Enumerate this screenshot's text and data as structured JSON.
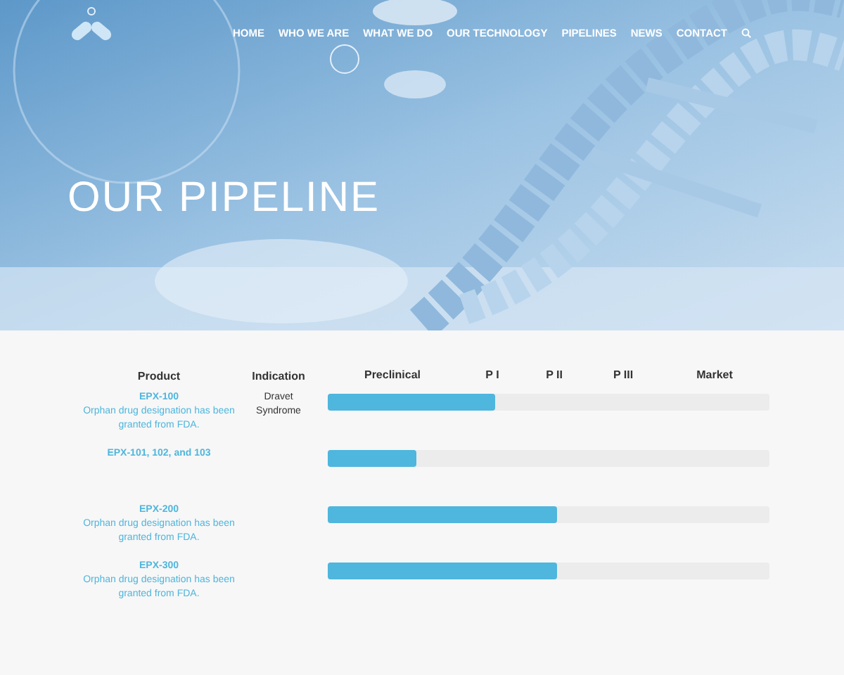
{
  "nav": [
    {
      "label": "HOME"
    },
    {
      "label": "WHO WE ARE"
    },
    {
      "label": "WHAT WE DO"
    },
    {
      "label": "OUR TECHNOLOGY"
    },
    {
      "label": "PIPELINES"
    },
    {
      "label": "NEWS"
    },
    {
      "label": "CONTACT"
    }
  ],
  "hero": {
    "title": "OUR PIPELINE"
  },
  "table": {
    "columns": [
      "Product",
      "Indication"
    ],
    "stages": [
      "Preclinical",
      "P I",
      "P II",
      "P III",
      "Market"
    ],
    "rows": [
      {
        "product": "EPX-100",
        "note": "Orphan drug designation has been granted from FDA.",
        "indication": "Dravet Syndrome",
        "level": 0.38
      },
      {
        "product": "EPX-101, 102, and 103",
        "level": 0.2
      },
      {
        "product": "EPX-200",
        "note": "Orphan drug designation has been granted from FDA.",
        "level": 0.52
      },
      {
        "product": "EPX-300",
        "note": "Orphan drug designation has been granted from FDA.",
        "level": 0.52
      }
    ]
  }
}
